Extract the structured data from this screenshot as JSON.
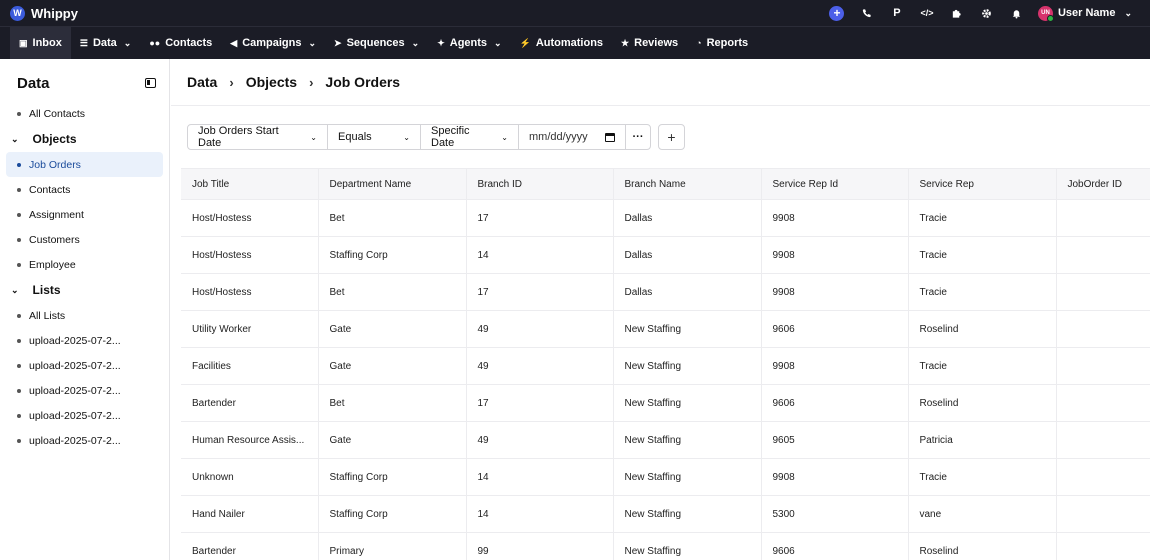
{
  "app": {
    "name": "Whippy",
    "logo_letter": "W"
  },
  "topbar": {
    "icons": [
      "plus-icon",
      "phone-icon",
      "p-icon",
      "code-icon",
      "puzzle-icon",
      "gear-icon",
      "bell-icon"
    ],
    "p_label": "P",
    "code_label": "</>",
    "user_initials": "UN",
    "user_name": "User Name"
  },
  "nav": [
    {
      "label": "Inbox",
      "icon": "inbox-icon",
      "dropdown": false,
      "active": true
    },
    {
      "label": "Data",
      "icon": "database-icon",
      "dropdown": true
    },
    {
      "label": "Contacts",
      "icon": "users-icon",
      "dropdown": false
    },
    {
      "label": "Campaigns",
      "icon": "megaphone-icon",
      "dropdown": true
    },
    {
      "label": "Sequences",
      "icon": "send-icon",
      "dropdown": true
    },
    {
      "label": "Agents",
      "icon": "sparkle-icon",
      "dropdown": true
    },
    {
      "label": "Automations",
      "icon": "bolt-icon",
      "dropdown": false
    },
    {
      "label": "Reviews",
      "icon": "star-icon",
      "dropdown": false
    },
    {
      "label": "Reports",
      "icon": "chart-icon",
      "dropdown": false
    }
  ],
  "sidebar": {
    "title": "Data",
    "all_contacts": "All Contacts",
    "objects_label": "Objects",
    "objects": [
      "Job Orders",
      "Contacts",
      "Assignment",
      "Customers",
      "Employee"
    ],
    "lists_label": "Lists",
    "lists": [
      "All Lists",
      "upload-2025-07-2...",
      "upload-2025-07-2...",
      "upload-2025-07-2...",
      "upload-2025-07-2...",
      "upload-2025-07-2..."
    ]
  },
  "breadcrumb": [
    "Data",
    "Objects",
    "Job Orders"
  ],
  "filter": {
    "field": "Job Orders Start Date",
    "operator": "Equals",
    "date_mode": "Specific Date",
    "date_placeholder": "mm/dd/yyyy",
    "more": "···",
    "add": "+"
  },
  "table": {
    "columns": [
      "Job Title",
      "Department Name",
      "Branch ID",
      "Branch Name",
      "Service Rep Id",
      "Service Rep",
      "JobOrder ID"
    ],
    "rows": [
      [
        "Host/Hostess",
        "Bet",
        "17",
        "Dallas",
        "9908",
        "Tracie",
        ""
      ],
      [
        "Host/Hostess",
        "Staffing Corp",
        "14",
        "Dallas",
        "9908",
        "Tracie",
        ""
      ],
      [
        "Host/Hostess",
        "Bet",
        "17",
        "Dallas",
        "9908",
        "Tracie",
        ""
      ],
      [
        "Utility Worker",
        "Gate",
        "49",
        "New Staffing",
        "9606",
        "Roselind",
        ""
      ],
      [
        "Facilities",
        "Gate",
        "49",
        "New Staffing",
        "9908",
        "Tracie",
        ""
      ],
      [
        "Bartender",
        "Bet",
        "17",
        "New Staffing",
        "9606",
        "Roselind",
        ""
      ],
      [
        "Human Resource Assis...",
        "Gate",
        "49",
        "New Staffing",
        "9605",
        "Patricia",
        ""
      ],
      [
        "Unknown",
        "Staffing Corp",
        "14",
        "New Staffing",
        "9908",
        "Tracie",
        ""
      ],
      [
        "Hand Nailer",
        "Staffing Corp",
        "14",
        "New Staffing",
        "5300",
        "vane",
        ""
      ],
      [
        "Bartender",
        "Primary",
        "99",
        "New Staffing",
        "9606",
        "Roselind",
        ""
      ]
    ]
  },
  "colors": {
    "topbar_bg": "#1b1c26",
    "accent": "#4c5fe8",
    "active_side_bg": "#eaf1fb",
    "active_side_text": "#1a4b9b"
  }
}
